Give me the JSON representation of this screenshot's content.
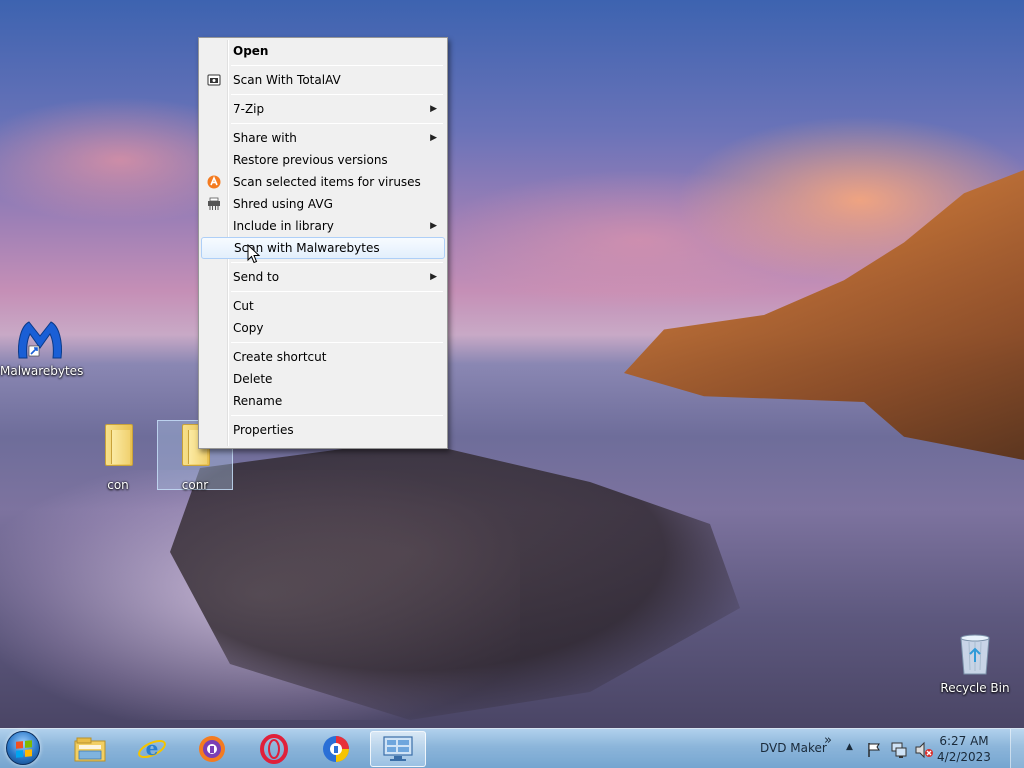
{
  "desktop": {
    "icons": [
      {
        "label": "Malwarebytes"
      },
      {
        "label": "con"
      },
      {
        "label": "conr"
      },
      {
        "label": "Recycle Bin"
      }
    ]
  },
  "context_menu": {
    "items": [
      {
        "label": "Open",
        "icon": "none",
        "submenu": false,
        "bold": true
      },
      {
        "label": "Scan With TotalAV",
        "icon": "totalav-icon",
        "submenu": false
      },
      {
        "label": "7-Zip",
        "icon": "none",
        "submenu": true
      },
      {
        "label": "Share with",
        "icon": "none",
        "submenu": true
      },
      {
        "label": "Restore previous versions",
        "icon": "none",
        "submenu": false
      },
      {
        "label": "Scan selected items for viruses",
        "icon": "avast-icon",
        "submenu": false
      },
      {
        "label": "Shred using AVG",
        "icon": "shredder-icon",
        "submenu": false
      },
      {
        "label": "Include in library",
        "icon": "none",
        "submenu": true
      },
      {
        "label": "Scan with Malwarebytes",
        "icon": "none",
        "submenu": false,
        "hover": true
      },
      {
        "label": "Send to",
        "icon": "none",
        "submenu": true
      },
      {
        "label": "Cut",
        "icon": "none",
        "submenu": false
      },
      {
        "label": "Copy",
        "icon": "none",
        "submenu": false
      },
      {
        "label": "Create shortcut",
        "icon": "none",
        "submenu": false
      },
      {
        "label": "Delete",
        "icon": "none",
        "submenu": false
      },
      {
        "label": "Rename",
        "icon": "none",
        "submenu": false
      },
      {
        "label": "Properties",
        "icon": "none",
        "submenu": false
      }
    ],
    "submenu_arrow": "▶"
  },
  "taskbar": {
    "pinned": [
      "start-orb",
      "file-explorer-icon",
      "internet-explorer-icon",
      "avast-browser-icon",
      "opera-icon",
      "avg-browser-icon",
      "remote-desktop-icon"
    ],
    "toolbar_label": "DVD Maker",
    "overflow_glyph": "»",
    "tray_up": "▲",
    "clock_time": "6:27 AM",
    "clock_date": "4/2/2023"
  },
  "colors": {
    "menu_bg": "#f0f0f0",
    "menu_hover": "#e3effc",
    "taskbar": "#8ab4db",
    "accent_orange": "#f47b20"
  }
}
